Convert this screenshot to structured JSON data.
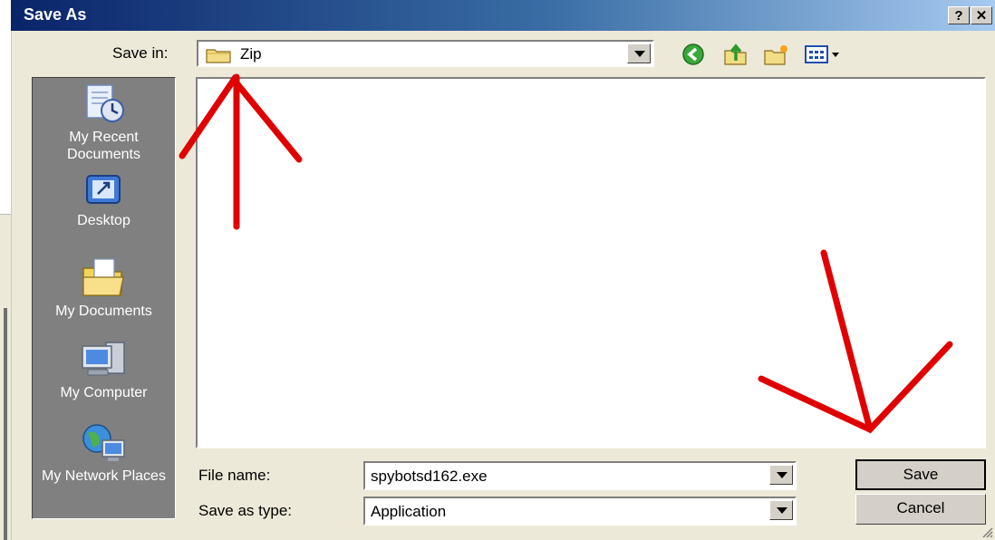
{
  "dialog": {
    "title": "Save As",
    "help_label": "?",
    "close_label": "✕"
  },
  "savein": {
    "label": "Save in:",
    "value": "Zip"
  },
  "toolbar": {
    "icons": [
      "back-icon",
      "up-folder-icon",
      "new-folder-icon",
      "views-menu-icon"
    ]
  },
  "places": [
    {
      "label": "My Recent Documents",
      "icon": "recent-documents-icon"
    },
    {
      "label": "Desktop",
      "icon": "desktop-icon"
    },
    {
      "label": "My Documents",
      "icon": "my-documents-icon"
    },
    {
      "label": "My Computer",
      "icon": "my-computer-icon"
    },
    {
      "label": "My Network Places",
      "icon": "network-places-icon"
    }
  ],
  "filename": {
    "label": "File name:",
    "value": "spybotsd162.exe"
  },
  "savetype": {
    "label": "Save as type:",
    "value": "Application"
  },
  "buttons": {
    "save": "Save",
    "cancel": "Cancel"
  },
  "colors": {
    "titlebar": "#0a246a",
    "annotation": "#e00000",
    "places_bg": "#808080"
  }
}
